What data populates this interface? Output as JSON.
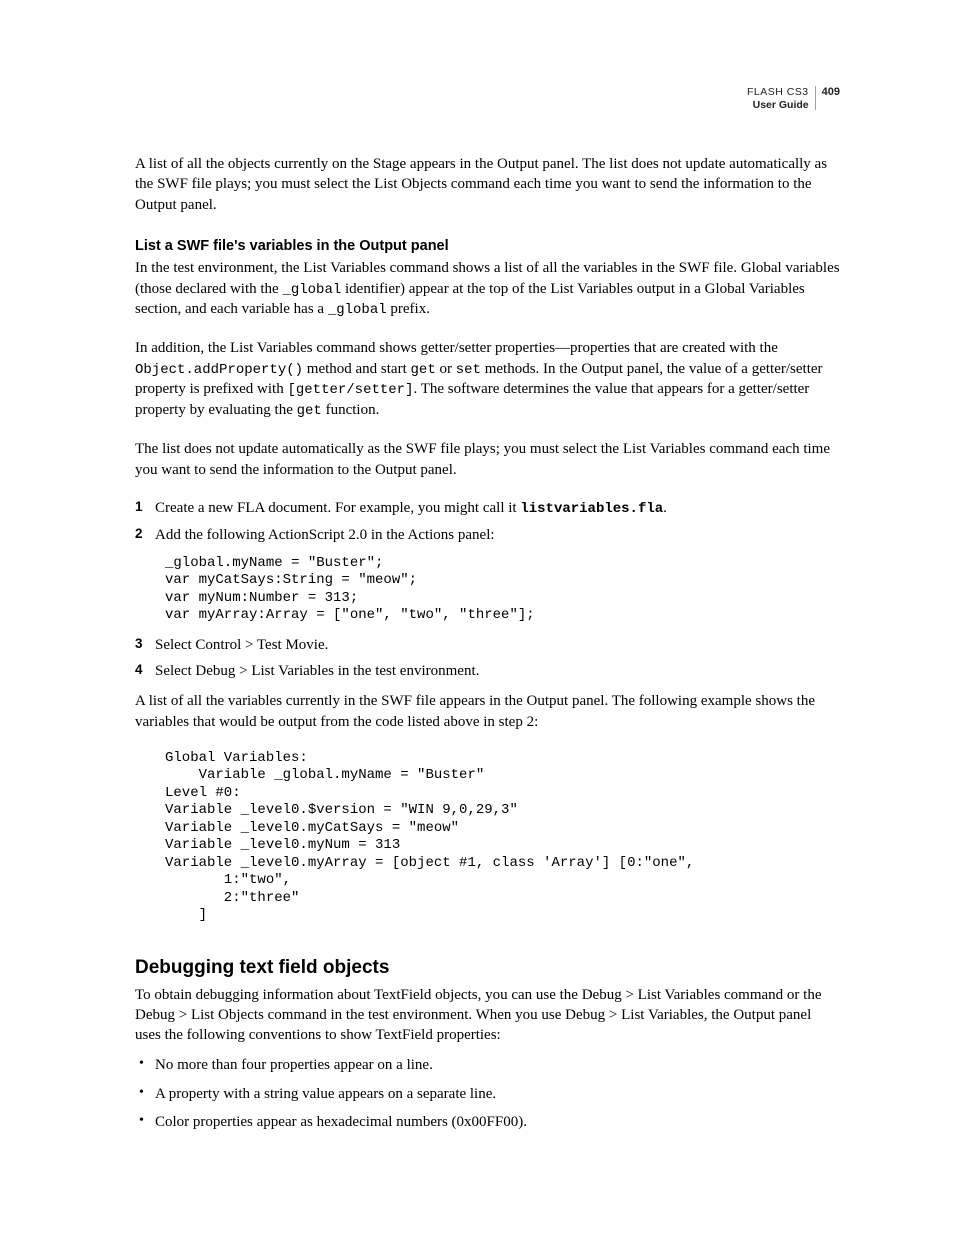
{
  "header": {
    "product": "FLASH CS3",
    "sub": "User Guide",
    "page": "409"
  },
  "intro": {
    "p1": "A list of all the objects currently on the Stage appears in the Output panel. The list does not update automatically as the SWF file plays; you must select the List Objects command each time you want to send the information to the Output panel."
  },
  "sec1": {
    "heading": "List a SWF file's variables in the Output panel",
    "p1a": "In the test environment, the List Variables command shows a list of all the variables in the SWF file. Global variables (those declared with the ",
    "p1b": "_global",
    "p1c": " identifier) appear at the top of the List Variables output in a Global Variables section, and each variable has a ",
    "p1d": "_global",
    "p1e": " prefix.",
    "p2a": "In addition, the List Variables command shows getter/setter properties—properties that are created with the ",
    "p2b": "Object.addProperty()",
    "p2c": " method and start ",
    "p2d": "get",
    "p2e": " or ",
    "p2f": "set",
    "p2g": " methods. In the Output panel, the value of a getter/setter property is prefixed with ",
    "p2h": "[getter/setter]",
    "p2i": ". The software determines the value that appears for a getter/setter property by evaluating the ",
    "p2j": "get",
    "p2k": " function.",
    "p3": "The list does not update automatically as the SWF file plays; you must select the List Variables command each time you want to send the information to the Output panel."
  },
  "steps1": {
    "s1a": "Create a new FLA document. For example, you might call it ",
    "s1b": "listvariables.fla",
    "s1c": ".",
    "s2": "Add the following ActionScript 2.0 in the Actions panel:",
    "code1": "_global.myName = \"Buster\";\nvar myCatSays:String = \"meow\";\nvar myNum:Number = 313;\nvar myArray:Array = [\"one\", \"two\", \"three\"];",
    "s3": "Select Control > Test Movie.",
    "s4": "Select Debug > List Variables in the test environment."
  },
  "out": {
    "p1": "A list of all the variables currently in the SWF file appears in the Output panel. The following example shows the variables that would be output from the code listed above in step 2:",
    "code": "Global Variables:\n    Variable _global.myName = \"Buster\"\nLevel #0:\nVariable _level0.$version = \"WIN 9,0,29,3\"\nVariable _level0.myCatSays = \"meow\"\nVariable _level0.myNum = 313\nVariable _level0.myArray = [object #1, class 'Array'] [0:\"one\",\n       1:\"two\",\n       2:\"three\"\n    ]"
  },
  "sec2": {
    "heading": "Debugging text field objects",
    "p1": "To obtain debugging information about TextField objects, you can use the Debug > List Variables command or the Debug > List Objects command in the test environment. When you use Debug > List Variables, the Output panel uses the following conventions to show TextField properties:",
    "b1": "No more than four properties appear on a line.",
    "b2": "A property with a string value appears on a separate line.",
    "b3": "Color properties appear as hexadecimal numbers (0x00FF00)."
  }
}
